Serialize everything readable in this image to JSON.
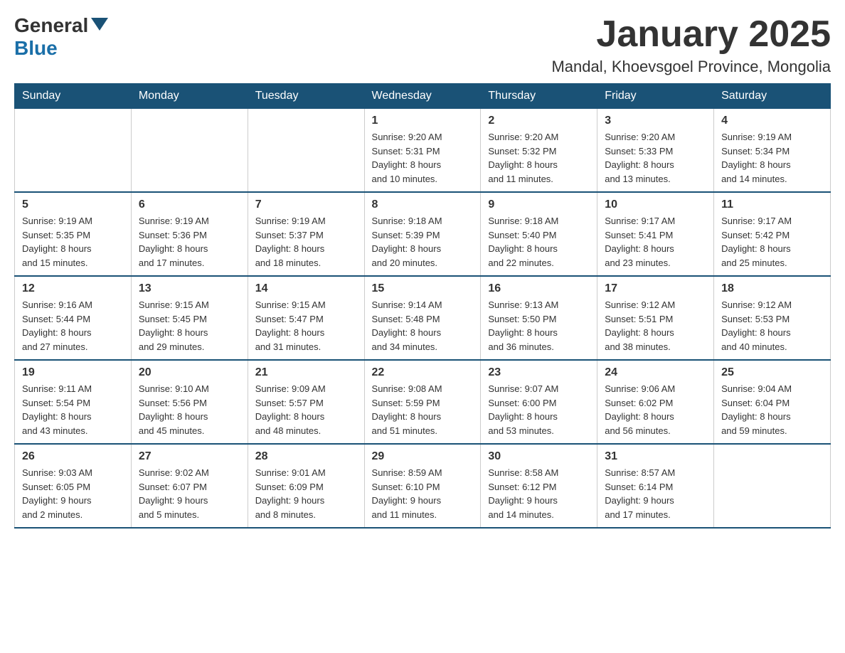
{
  "logo": {
    "general": "General",
    "blue": "Blue",
    "triangle": "▶"
  },
  "header": {
    "title": "January 2025",
    "subtitle": "Mandal, Khoevsgoel Province, Mongolia"
  },
  "weekdays": [
    "Sunday",
    "Monday",
    "Tuesday",
    "Wednesday",
    "Thursday",
    "Friday",
    "Saturday"
  ],
  "weeks": [
    [
      {
        "day": "",
        "info": ""
      },
      {
        "day": "",
        "info": ""
      },
      {
        "day": "",
        "info": ""
      },
      {
        "day": "1",
        "info": "Sunrise: 9:20 AM\nSunset: 5:31 PM\nDaylight: 8 hours\nand 10 minutes."
      },
      {
        "day": "2",
        "info": "Sunrise: 9:20 AM\nSunset: 5:32 PM\nDaylight: 8 hours\nand 11 minutes."
      },
      {
        "day": "3",
        "info": "Sunrise: 9:20 AM\nSunset: 5:33 PM\nDaylight: 8 hours\nand 13 minutes."
      },
      {
        "day": "4",
        "info": "Sunrise: 9:19 AM\nSunset: 5:34 PM\nDaylight: 8 hours\nand 14 minutes."
      }
    ],
    [
      {
        "day": "5",
        "info": "Sunrise: 9:19 AM\nSunset: 5:35 PM\nDaylight: 8 hours\nand 15 minutes."
      },
      {
        "day": "6",
        "info": "Sunrise: 9:19 AM\nSunset: 5:36 PM\nDaylight: 8 hours\nand 17 minutes."
      },
      {
        "day": "7",
        "info": "Sunrise: 9:19 AM\nSunset: 5:37 PM\nDaylight: 8 hours\nand 18 minutes."
      },
      {
        "day": "8",
        "info": "Sunrise: 9:18 AM\nSunset: 5:39 PM\nDaylight: 8 hours\nand 20 minutes."
      },
      {
        "day": "9",
        "info": "Sunrise: 9:18 AM\nSunset: 5:40 PM\nDaylight: 8 hours\nand 22 minutes."
      },
      {
        "day": "10",
        "info": "Sunrise: 9:17 AM\nSunset: 5:41 PM\nDaylight: 8 hours\nand 23 minutes."
      },
      {
        "day": "11",
        "info": "Sunrise: 9:17 AM\nSunset: 5:42 PM\nDaylight: 8 hours\nand 25 minutes."
      }
    ],
    [
      {
        "day": "12",
        "info": "Sunrise: 9:16 AM\nSunset: 5:44 PM\nDaylight: 8 hours\nand 27 minutes."
      },
      {
        "day": "13",
        "info": "Sunrise: 9:15 AM\nSunset: 5:45 PM\nDaylight: 8 hours\nand 29 minutes."
      },
      {
        "day": "14",
        "info": "Sunrise: 9:15 AM\nSunset: 5:47 PM\nDaylight: 8 hours\nand 31 minutes."
      },
      {
        "day": "15",
        "info": "Sunrise: 9:14 AM\nSunset: 5:48 PM\nDaylight: 8 hours\nand 34 minutes."
      },
      {
        "day": "16",
        "info": "Sunrise: 9:13 AM\nSunset: 5:50 PM\nDaylight: 8 hours\nand 36 minutes."
      },
      {
        "day": "17",
        "info": "Sunrise: 9:12 AM\nSunset: 5:51 PM\nDaylight: 8 hours\nand 38 minutes."
      },
      {
        "day": "18",
        "info": "Sunrise: 9:12 AM\nSunset: 5:53 PM\nDaylight: 8 hours\nand 40 minutes."
      }
    ],
    [
      {
        "day": "19",
        "info": "Sunrise: 9:11 AM\nSunset: 5:54 PM\nDaylight: 8 hours\nand 43 minutes."
      },
      {
        "day": "20",
        "info": "Sunrise: 9:10 AM\nSunset: 5:56 PM\nDaylight: 8 hours\nand 45 minutes."
      },
      {
        "day": "21",
        "info": "Sunrise: 9:09 AM\nSunset: 5:57 PM\nDaylight: 8 hours\nand 48 minutes."
      },
      {
        "day": "22",
        "info": "Sunrise: 9:08 AM\nSunset: 5:59 PM\nDaylight: 8 hours\nand 51 minutes."
      },
      {
        "day": "23",
        "info": "Sunrise: 9:07 AM\nSunset: 6:00 PM\nDaylight: 8 hours\nand 53 minutes."
      },
      {
        "day": "24",
        "info": "Sunrise: 9:06 AM\nSunset: 6:02 PM\nDaylight: 8 hours\nand 56 minutes."
      },
      {
        "day": "25",
        "info": "Sunrise: 9:04 AM\nSunset: 6:04 PM\nDaylight: 8 hours\nand 59 minutes."
      }
    ],
    [
      {
        "day": "26",
        "info": "Sunrise: 9:03 AM\nSunset: 6:05 PM\nDaylight: 9 hours\nand 2 minutes."
      },
      {
        "day": "27",
        "info": "Sunrise: 9:02 AM\nSunset: 6:07 PM\nDaylight: 9 hours\nand 5 minutes."
      },
      {
        "day": "28",
        "info": "Sunrise: 9:01 AM\nSunset: 6:09 PM\nDaylight: 9 hours\nand 8 minutes."
      },
      {
        "day": "29",
        "info": "Sunrise: 8:59 AM\nSunset: 6:10 PM\nDaylight: 9 hours\nand 11 minutes."
      },
      {
        "day": "30",
        "info": "Sunrise: 8:58 AM\nSunset: 6:12 PM\nDaylight: 9 hours\nand 14 minutes."
      },
      {
        "day": "31",
        "info": "Sunrise: 8:57 AM\nSunset: 6:14 PM\nDaylight: 9 hours\nand 17 minutes."
      },
      {
        "day": "",
        "info": ""
      }
    ]
  ]
}
